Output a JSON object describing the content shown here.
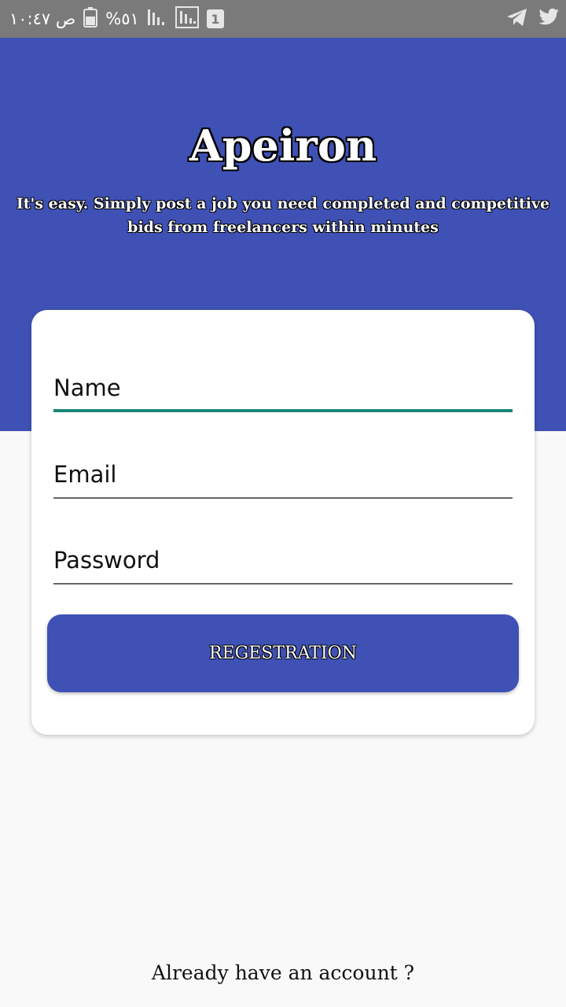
{
  "status_bar": {
    "time": "ص ١٠:٤٧",
    "battery_percent": "%٥١",
    "sim_badge": "1",
    "icons": [
      "battery-icon",
      "signal-icon",
      "signal-icon",
      "sim-icon",
      "telegram-icon",
      "twitter-icon"
    ]
  },
  "header": {
    "title": "Apeiron",
    "subtitle": "It's easy. Simply post a job you need completed and competitive bids from freelancers within minutes",
    "color": "#3f51b5"
  },
  "form": {
    "name_placeholder": "Name",
    "email_placeholder": "Email",
    "password_placeholder": "Password",
    "focused_field": "name",
    "accent_color": "#1a8776"
  },
  "register_button": {
    "label": "REGESTRATION"
  },
  "footer": {
    "login_link": "Already have an account ?"
  }
}
